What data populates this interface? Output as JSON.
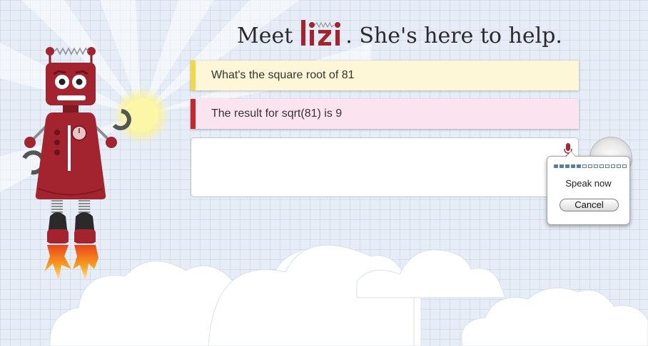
{
  "header": {
    "meet_text": "Meet",
    "brand": "lizi",
    "tagline_text": ". She's here to help."
  },
  "conversation": [
    {
      "role": "user",
      "text": "What's the square root of 81",
      "accent": "#f1d849"
    },
    {
      "role": "assistant",
      "text": "The result for sqrt(81) is 9",
      "accent": "#c9252c"
    }
  ],
  "input": {
    "value": "",
    "placeholder": ""
  },
  "voice_popup": {
    "status": "Speak now",
    "cancel_label": "Cancel",
    "level_segments_lit": 5,
    "level_segments_total": 13
  },
  "icons": {
    "mic": "microphone-icon",
    "robot": "robot-mascot",
    "logo": "lizi-logo"
  },
  "colors": {
    "brand_red": "#a3232f",
    "question_accent": "#f1d849",
    "answer_accent": "#c9252c",
    "meter_blue": "#5a7ea3"
  }
}
